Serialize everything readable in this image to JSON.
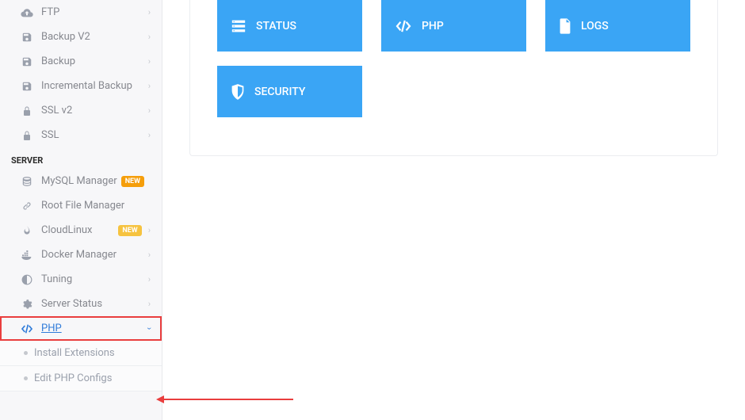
{
  "sidebar": {
    "items": [
      {
        "label": "FTP"
      },
      {
        "label": "Backup V2"
      },
      {
        "label": "Backup"
      },
      {
        "label": "Incremental Backup"
      },
      {
        "label": "SSL v2"
      },
      {
        "label": "SSL"
      }
    ],
    "group_title": "SERVER",
    "server_items": [
      {
        "label": "MySQL Manager",
        "badge": "NEW"
      },
      {
        "label": "Root File Manager"
      },
      {
        "label": "CloudLinux",
        "badge": "NEW"
      },
      {
        "label": "Docker Manager"
      },
      {
        "label": "Tuning"
      },
      {
        "label": "Server Status"
      },
      {
        "label": "PHP"
      }
    ],
    "sub_items": [
      {
        "label": "Install Extensions"
      },
      {
        "label": "Edit PHP Configs"
      }
    ]
  },
  "tiles": [
    {
      "label": "STATUS"
    },
    {
      "label": "PHP"
    },
    {
      "label": "LOGS"
    },
    {
      "label": "SECURITY"
    }
  ]
}
